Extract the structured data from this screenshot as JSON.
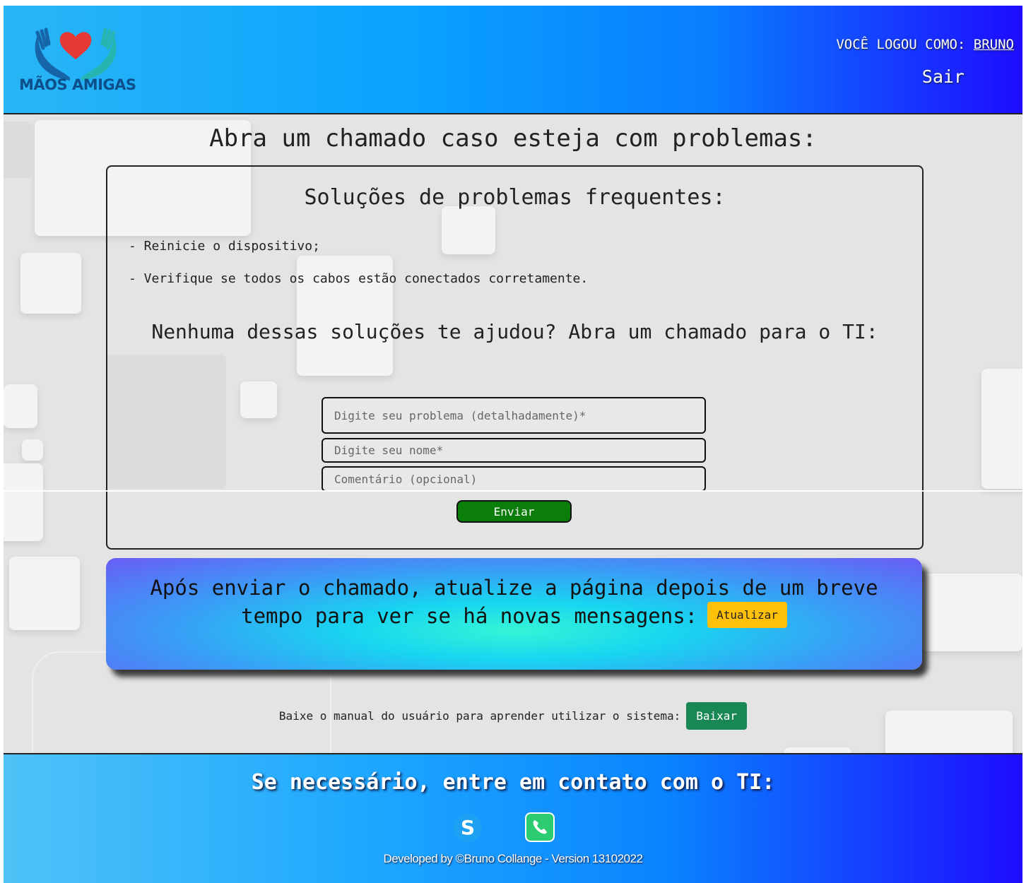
{
  "header": {
    "logo_text": "MÃOS AMIGAS",
    "login_prefix": "VOCÊ LOGOU COMO:",
    "user_name": "BRUNO",
    "logout_label": "Sair"
  },
  "main": {
    "title": "Abra um chamado caso esteja com problemas:",
    "panel": {
      "title": "Soluções de problemas frequentes:",
      "tips": [
        "- Reinicie o dispositivo;",
        "- Verifique se todos os cabos estão conectados corretamente."
      ],
      "ask": "Nenhuma dessas soluções te ajudou? Abra um chamado para o TI:",
      "form": {
        "problem_placeholder": "Digite seu problema (detalhadamente)*",
        "name_placeholder": "Digite seu nome*",
        "comment_placeholder": "Comentário (opcional)",
        "send_label": "Enviar"
      }
    },
    "notice": {
      "text": "Após enviar o chamado, atualize a página depois de um breve tempo para ver se há novas mensagens:",
      "refresh_label": "Atualizar"
    },
    "manual": {
      "text": "Baixe o manual do usuário para aprender utilizar o sistema:",
      "download_label": "Baixar"
    }
  },
  "footer": {
    "title": "Se necessário, entre em contato com o TI:",
    "contact_icons": [
      "skype-icon",
      "phone-icon"
    ],
    "credits": "Developed by ©Bruno Collange - Version 13102022"
  },
  "colors": {
    "send_button": "#0a7d0a",
    "refresh_button": "#ffc107",
    "download_button": "#198754",
    "logo_heart": "#e53935",
    "logo_hands": "#1e88c8"
  }
}
